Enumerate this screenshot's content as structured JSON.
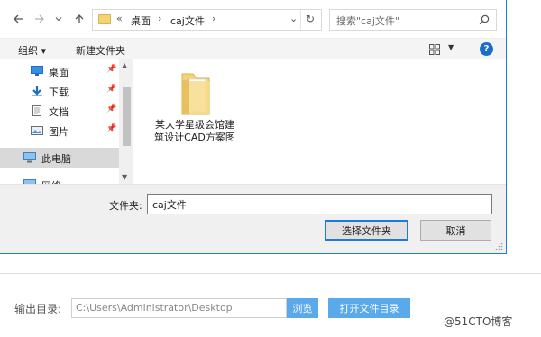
{
  "address_bar": {
    "back_icon": "arrow-left-icon",
    "forward_icon": "arrow-right-icon",
    "recent_icon": "chevron-down-icon",
    "up_icon": "arrow-up-icon",
    "overflow": "«",
    "crumbs": [
      "桌面",
      "caj文件"
    ],
    "refresh_icon": "refresh-icon"
  },
  "search": {
    "placeholder": "搜索\"caj文件\""
  },
  "toolbar": {
    "organize_label": "组织 ▾",
    "new_folder_label": "新建文件夹",
    "help_label": "?"
  },
  "nav_pane": {
    "items": [
      {
        "label": "桌面",
        "icon": "desktop-icon",
        "pinned": true
      },
      {
        "label": "下载",
        "icon": "download-icon",
        "pinned": true
      },
      {
        "label": "文档",
        "icon": "document-icon",
        "pinned": true
      },
      {
        "label": "图片",
        "icon": "pictures-icon",
        "pinned": true
      },
      {
        "label": "此电脑",
        "icon": "computer-icon",
        "pinned": false,
        "selected": true
      },
      {
        "label": "网络",
        "icon": "network-icon",
        "pinned": false
      }
    ]
  },
  "content": {
    "files": [
      {
        "name": "某大学星级会馆建筑设计CAD方案图",
        "icon": "folder-icon"
      }
    ]
  },
  "dialog_footer": {
    "filename_label": "文件夹:",
    "filename_value": "caj文件",
    "select_button": "选择文件夹",
    "cancel_button": "取消"
  },
  "host_page": {
    "output_label": "输出目录:",
    "output_path": "C:\\Users\\Administrator\\Desktop",
    "browse_button": "浏览",
    "open_folder_button": "打开文件目录",
    "watermark": "@51CTO博客"
  },
  "colors": {
    "accent": "#1a6ccd",
    "button_blue": "#5aa9ea",
    "selection_gray": "#d9d9d9",
    "folder_yellow": "#f3d475"
  }
}
